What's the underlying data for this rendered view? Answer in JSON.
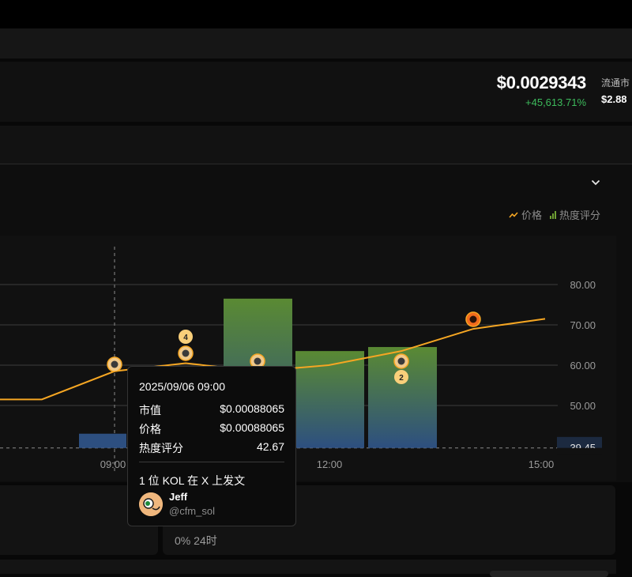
{
  "header": {
    "price": "$0.0029343",
    "change": "+45,613.71%",
    "market_cap_label": "流通市",
    "market_cap_value": "$2.88"
  },
  "legend": {
    "price_label": "价格",
    "heat_label": "热度评分"
  },
  "chart_data": {
    "type": "line",
    "x_ticks": [
      "09:00",
      "12:00",
      "15:00"
    ],
    "y_ticks": [
      "80.00",
      "70.00",
      "60.00",
      "50.00"
    ],
    "current_heat_label": "39.45",
    "heat_bars": [
      {
        "value": 43
      },
      {
        "value": 76.5
      },
      {
        "value": 63.5
      },
      {
        "value": 64.5
      }
    ],
    "series": [
      {
        "values": [
          51.5,
          51.5,
          58.5,
          60.5,
          58.5,
          60.0,
          63.5,
          69.0,
          71.5
        ]
      }
    ],
    "kol_markers": [
      {
        "count": "",
        "icon": "kol-avatar-icon"
      },
      {
        "count": "4",
        "icon": "kol-avatar-icon"
      },
      {
        "count": "",
        "icon": "kol-avatar-icon"
      },
      {
        "count": "2",
        "icon": "kol-avatar-icon"
      },
      {
        "count": "",
        "icon": "kol-avatar-icon"
      }
    ],
    "colors": {
      "price": "#f5a623",
      "bar_top": "#5a8a33",
      "bar_bottom": "#2d4f80"
    }
  },
  "tooltip": {
    "date": "2025/09/06 09:00",
    "market_cap_label": "市值",
    "market_cap_value": "$0.00088065",
    "price_label": "价格",
    "price_value": "$0.00088065",
    "heat_label": "热度评分",
    "heat_value": "42.67",
    "kol_summary": "1 位 KOL 在 X 上发文",
    "kol_name": "Jeff",
    "kol_handle": "@cfm_sol"
  },
  "stats": {
    "change_text": "0% 24时"
  }
}
